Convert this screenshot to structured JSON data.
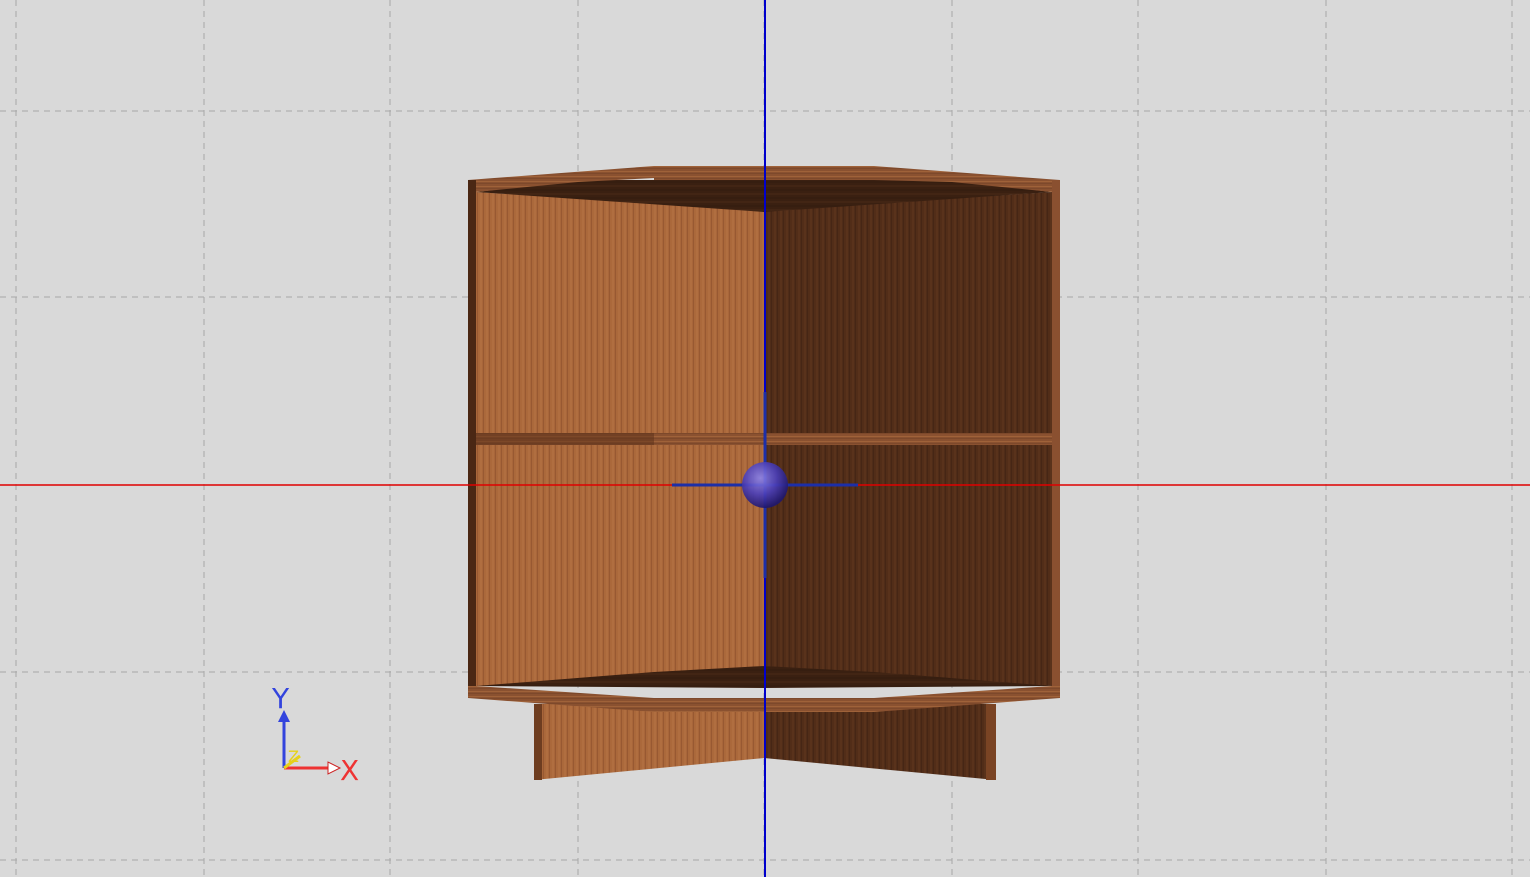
{
  "viewport": {
    "background": "#d9d9d9",
    "grid_color": "#a8a8a8"
  },
  "axes": {
    "x_label": "X",
    "y_label": "Y",
    "z_label": "Z",
    "x_color": "#ee3333",
    "y_color": "#3344dd",
    "z_color": "#e6d21a",
    "horizontal_axis_color": "#e00000",
    "vertical_axis_color": "#0000cc"
  },
  "model": {
    "name": "corner-cabinet",
    "wood_light": "#a8663a",
    "wood_mid": "#8a5130",
    "wood_dark": "#4f2c18",
    "wood_darkest": "#3a2011"
  },
  "gizmo": {
    "sphere_color": "#4b3fb8",
    "handle_color": "#1c2fa8"
  }
}
